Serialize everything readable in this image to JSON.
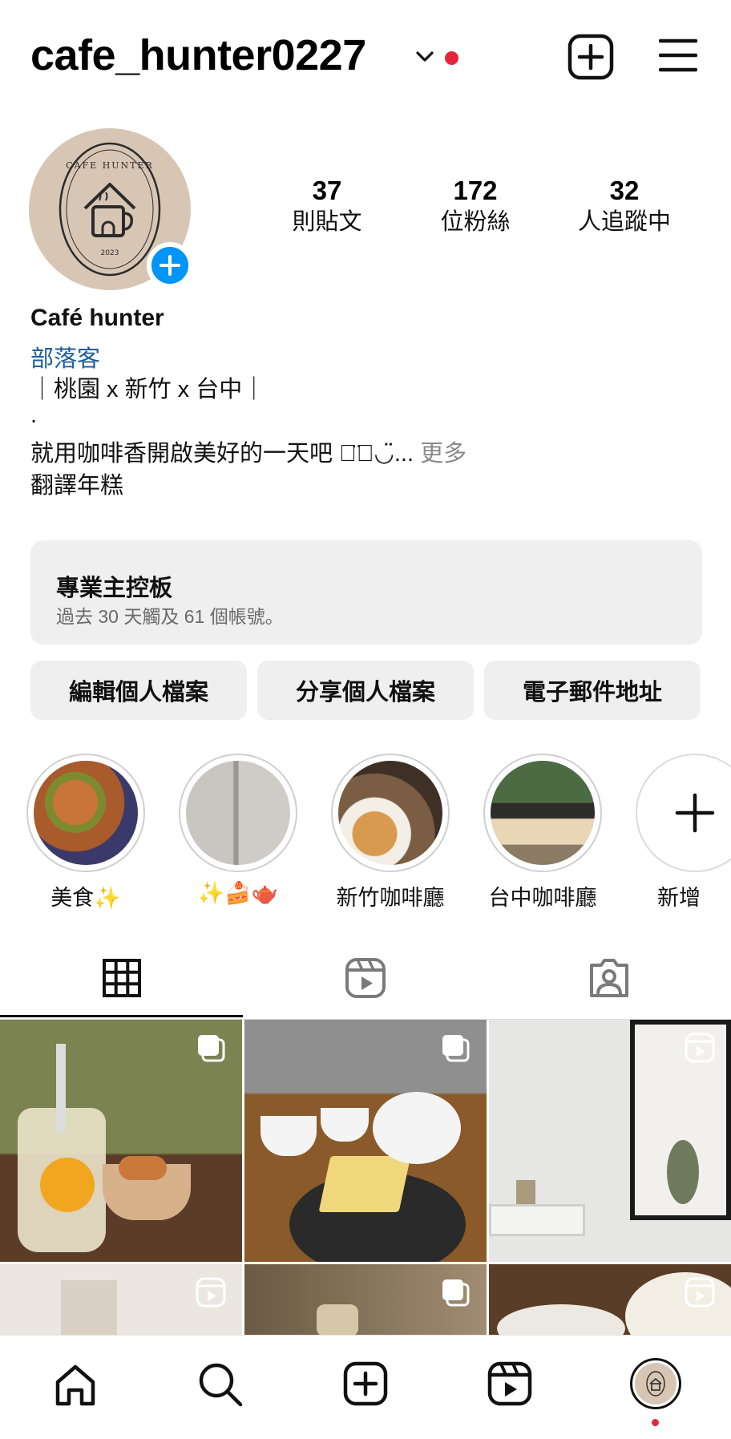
{
  "header": {
    "username": "cafe_hunter0227"
  },
  "profile": {
    "stats": [
      {
        "count": "37",
        "label": "則貼文"
      },
      {
        "count": "172",
        "label": "位粉絲"
      },
      {
        "count": "32",
        "label": "人追蹤中"
      }
    ],
    "display_name": "Café hunter",
    "category": "部落客",
    "bio_lines": [
      "｜桃園 x 新竹 x 台中｜",
      ".",
      "就用咖啡香開啟美好的一天吧 ◡̈⃝◡̈..."
    ],
    "more_label": "更多",
    "translate_label": "翻譯年糕"
  },
  "dashboard": {
    "title": "專業主控板",
    "subtitle": "過去 30 天觸及 61 個帳號。"
  },
  "actions": {
    "edit_label": "編輯個人檔案",
    "share_label": "分享個人檔案",
    "email_label": "電子郵件地址"
  },
  "highlights": [
    {
      "label": "美食✨"
    },
    {
      "label": "✨🍰🫖"
    },
    {
      "label": "新竹咖啡廳"
    },
    {
      "label": "台中咖啡廳"
    },
    {
      "label": "新增"
    }
  ],
  "avatar_text": {
    "top": "CAFE HUNTER",
    "year": "2023"
  },
  "colors": {
    "accent_blue": "#0095f6",
    "notification_red": "#e4263b",
    "category_link": "#1f5f9c"
  }
}
